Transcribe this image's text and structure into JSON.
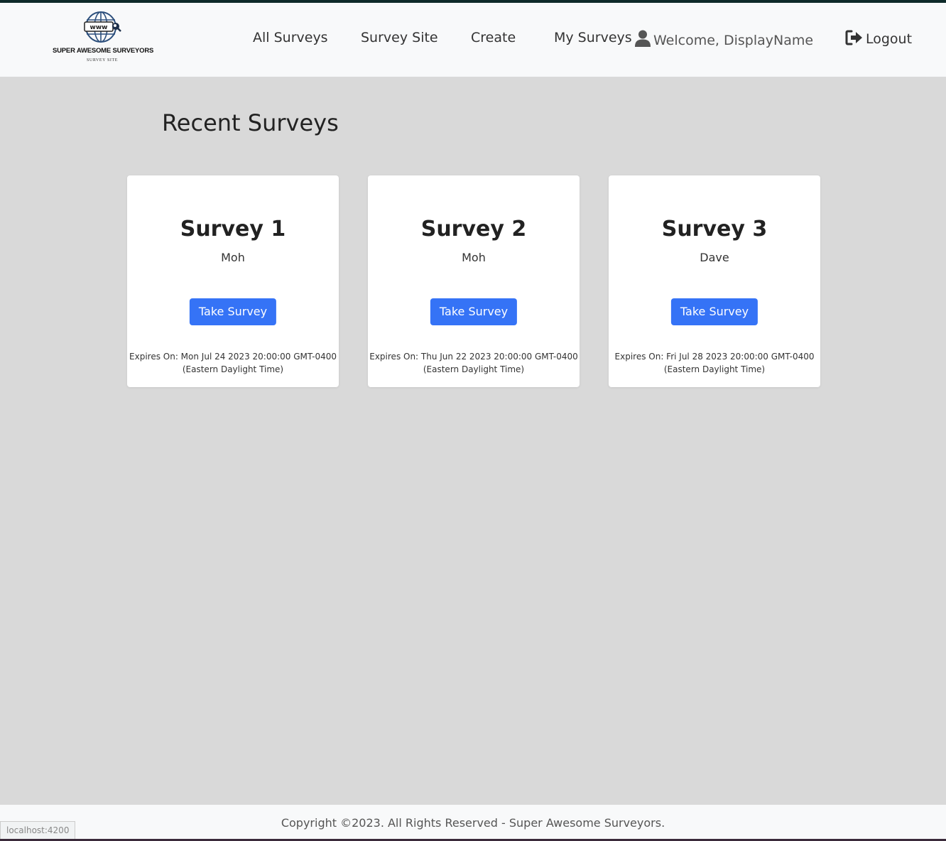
{
  "brand": {
    "logo_text": "www",
    "name": "SUPER AWESOME SURVEYORS",
    "tagline": "SURVEY SITE"
  },
  "nav": {
    "links": [
      "All Surveys",
      "Survey Site",
      "Create",
      "My Surveys"
    ],
    "welcome": "Welcome, DisplayName",
    "logout": "Logout"
  },
  "main": {
    "title": "Recent Surveys",
    "surveys": [
      {
        "title": "Survey 1",
        "author": "Moh",
        "button": "Take Survey",
        "expiry": "Expires On: Mon Jul 24 2023 20:00:00 GMT-0400 (Eastern Daylight Time)"
      },
      {
        "title": "Survey 2",
        "author": "Moh",
        "button": "Take Survey",
        "expiry": "Expires On: Thu Jun 22 2023 20:00:00 GMT-0400 (Eastern Daylight Time)"
      },
      {
        "title": "Survey 3",
        "author": "Dave",
        "button": "Take Survey",
        "expiry": "Expires On: Fri Jul 28 2023 20:00:00 GMT-0400 (Eastern Daylight Time)"
      }
    ]
  },
  "footer": {
    "copyright": "Copyright ©2023. All Rights Reserved - Super Awesome Surveyors."
  },
  "status_bar": {
    "url": "localhost:4200"
  },
  "icons": {
    "logo": "globe-icon",
    "user": "user-icon",
    "logout": "logout-icon"
  },
  "colors": {
    "primary_button": "#3573f6",
    "navbar_bg": "#f8f9fa",
    "page_bg": "#d9d9d9",
    "card_bg": "#ffffff"
  }
}
